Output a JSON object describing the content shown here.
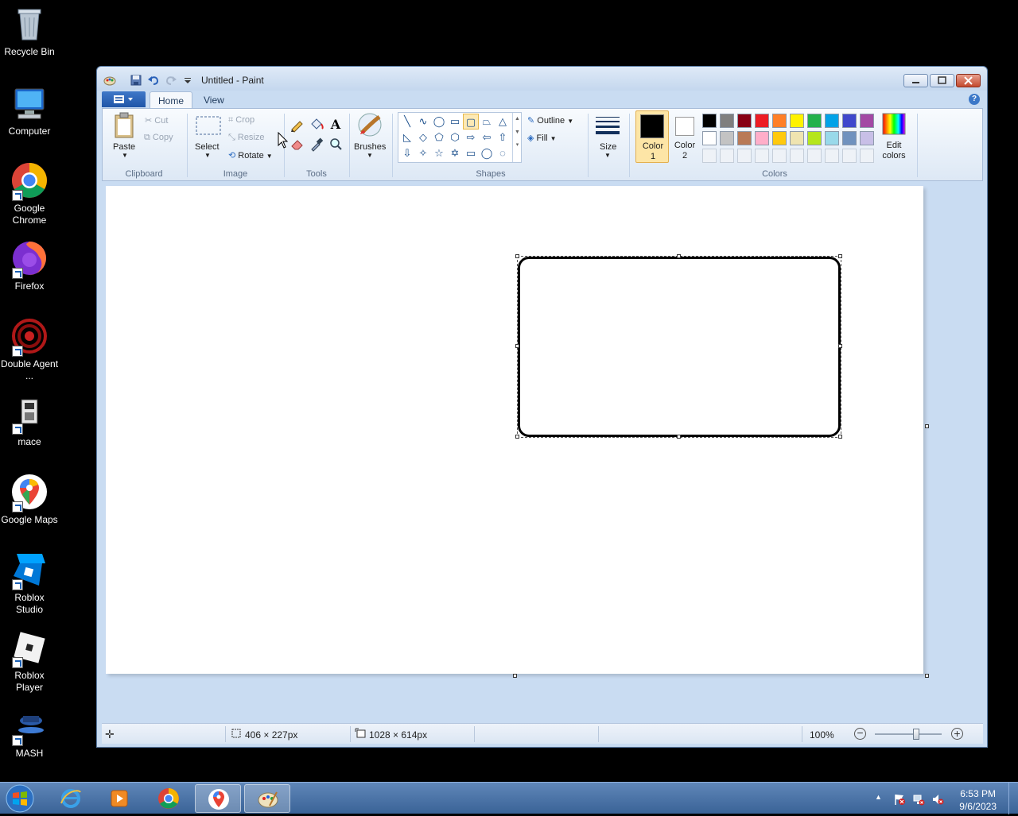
{
  "desktop": {
    "icons": [
      {
        "label": "Recycle Bin"
      },
      {
        "label": "Computer"
      },
      {
        "label": "Google Chrome"
      },
      {
        "label": "Firefox"
      },
      {
        "label": "Double Agent ..."
      },
      {
        "label": "mace"
      },
      {
        "label": "Google Maps"
      },
      {
        "label": "Roblox Studio"
      },
      {
        "label": "Roblox Player"
      },
      {
        "label": "MASH"
      }
    ]
  },
  "window": {
    "title": "Untitled - Paint",
    "tabs": [
      "Home",
      "View"
    ],
    "help_label": "?"
  },
  "ribbon": {
    "clipboard": {
      "label": "Clipboard",
      "paste": "Paste",
      "cut": "Cut",
      "copy": "Copy"
    },
    "image": {
      "label": "Image",
      "select": "Select",
      "crop": "Crop",
      "resize": "Resize",
      "rotate": "Rotate"
    },
    "tools": {
      "label": "Tools",
      "text_tool": "A"
    },
    "brushes": {
      "label": "Brushes"
    },
    "shapes": {
      "label": "Shapes",
      "outline": "Outline",
      "fill": "Fill"
    },
    "size": {
      "label": "Size"
    },
    "colors": {
      "label": "Colors",
      "color1": "Color 1",
      "color2": "Color 2",
      "edit_colors": "Edit colors",
      "color1_value": "#000000",
      "color2_value": "#ffffff",
      "palette_row1": [
        "#000000",
        "#7f7f7f",
        "#880015",
        "#ed1c24",
        "#ff7f27",
        "#fff200",
        "#22b14c",
        "#00a2e8",
        "#3f48cc",
        "#a349a4"
      ],
      "palette_row2": [
        "#ffffff",
        "#c3c3c3",
        "#b97a57",
        "#ffaec9",
        "#ffc90e",
        "#efe4b0",
        "#b5e61d",
        "#99d9ea",
        "#7092be",
        "#c8bfe7"
      ]
    }
  },
  "status": {
    "selection_size": "406 × 227px",
    "canvas_size": "1028 × 614px",
    "zoom": "100%"
  },
  "taskbar": {
    "time": "6:53 PM",
    "date": "9/6/2023"
  }
}
